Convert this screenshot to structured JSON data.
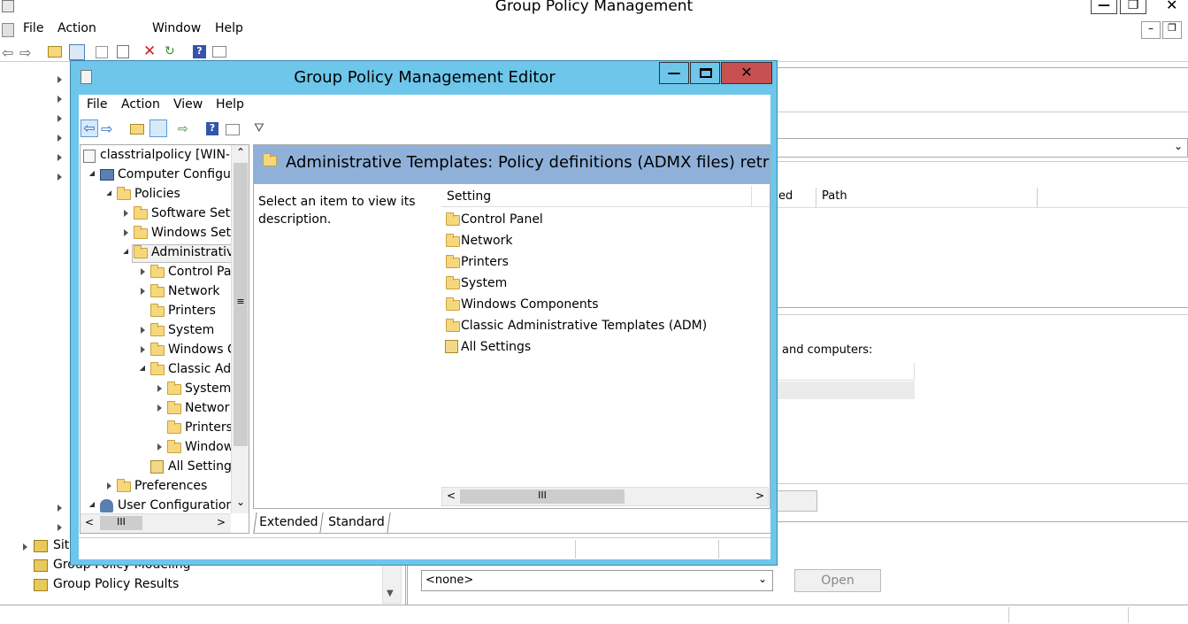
{
  "main_window": {
    "title": "Group Policy Management",
    "menu": [
      "File",
      "Action",
      "Window",
      "Help"
    ],
    "tree_bottom_items": [
      {
        "label": "Site"
      },
      {
        "label": "Group Policy Modeling"
      },
      {
        "label": "Group Policy Results"
      }
    ],
    "column_fragment": "ed",
    "path_column": "Path",
    "security_text": "and computers:",
    "wmi_select_value": "<none>",
    "open_button": "Open"
  },
  "editor": {
    "title": "Group Policy Management Editor",
    "menu": [
      "File",
      "Action",
      "View",
      "Help"
    ],
    "tree": {
      "root": "classtrialpolicy [WIN-F",
      "computer_config": "Computer Configur",
      "policies": "Policies",
      "software_settings": "Software Sett",
      "windows_settings": "Windows Sett",
      "admin_templates": "Administrativ",
      "control_panel": "Control Pa",
      "network": "Network",
      "printers": "Printers",
      "system": "System",
      "windows_components": "Windows C",
      "classic_adm": "Classic Adr",
      "classic_system": "System",
      "classic_network": "Networ",
      "classic_printers": "Printers",
      "classic_windows": "Window",
      "all_settings": "All Setting",
      "preferences": "Preferences",
      "user_config": "User Configuration"
    },
    "header_title": "Administrative Templates: Policy definitions (ADMX files) retrieved",
    "description": "Select an item to view its description.",
    "list_column": "Setting",
    "list_items": [
      {
        "label": "Control Panel",
        "icon": "folder-icon"
      },
      {
        "label": "Network",
        "icon": "folder-icon"
      },
      {
        "label": "Printers",
        "icon": "folder-icon"
      },
      {
        "label": "System",
        "icon": "folder-icon"
      },
      {
        "label": "Windows Components",
        "icon": "folder-icon"
      },
      {
        "label": "Classic Administrative Templates (ADM)",
        "icon": "folder-icon"
      },
      {
        "label": "All Settings",
        "icon": "settings-icon"
      }
    ],
    "tabs": [
      "Extended",
      "Standard"
    ]
  },
  "colors": {
    "editor_frame": "#6ec6ea",
    "header_band": "#8fb1d9",
    "close_button": "#c75050"
  }
}
